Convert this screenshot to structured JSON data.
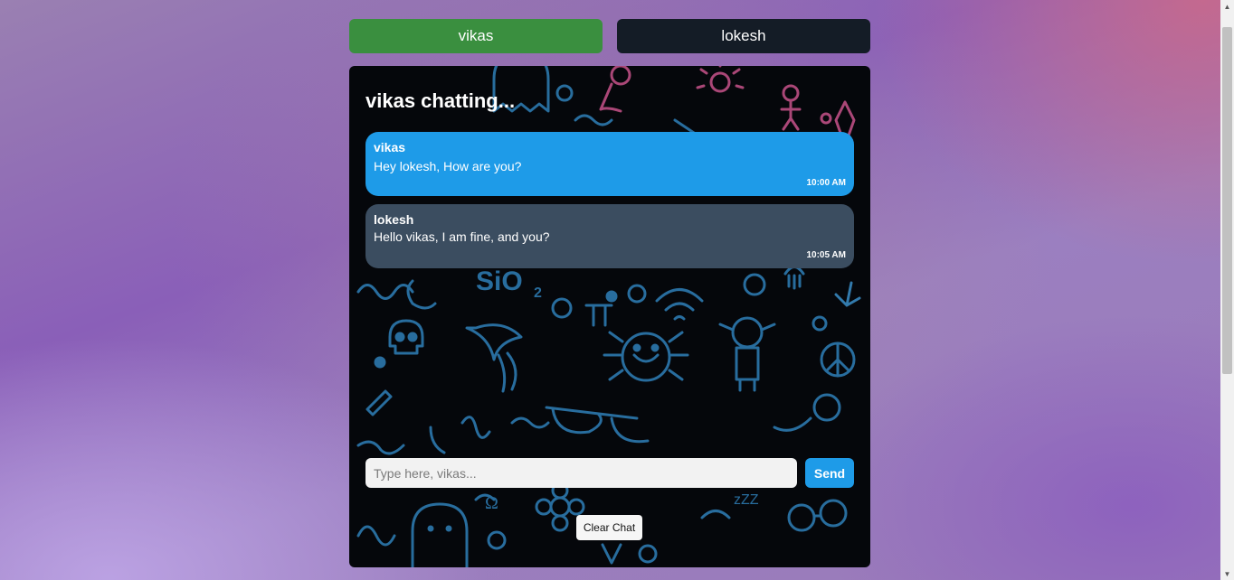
{
  "tabs": [
    {
      "label": "vikas",
      "active": true
    },
    {
      "label": "lokesh",
      "active": false
    }
  ],
  "chat": {
    "title": "vikas chatting...",
    "messages": [
      {
        "sender": "vikas",
        "text": "Hey lokesh, How are you?",
        "time": "10:00 AM",
        "from_self": true
      },
      {
        "sender": "lokesh",
        "text": "Hello vikas, I am fine, and you?",
        "time": "10:05 AM",
        "from_self": false
      }
    ],
    "input": {
      "placeholder": "Type here, vikas...",
      "value": ""
    },
    "send_label": "Send",
    "clear_label": "Clear Chat"
  },
  "colors": {
    "active_tab": "#3a8f3f",
    "inactive_tab": "#141c26",
    "self_bubble": "#1e9be8",
    "other_bubble": "#3b4d60",
    "doodle_blue": "#3b8fc9",
    "doodle_pink": "#c8538b"
  }
}
